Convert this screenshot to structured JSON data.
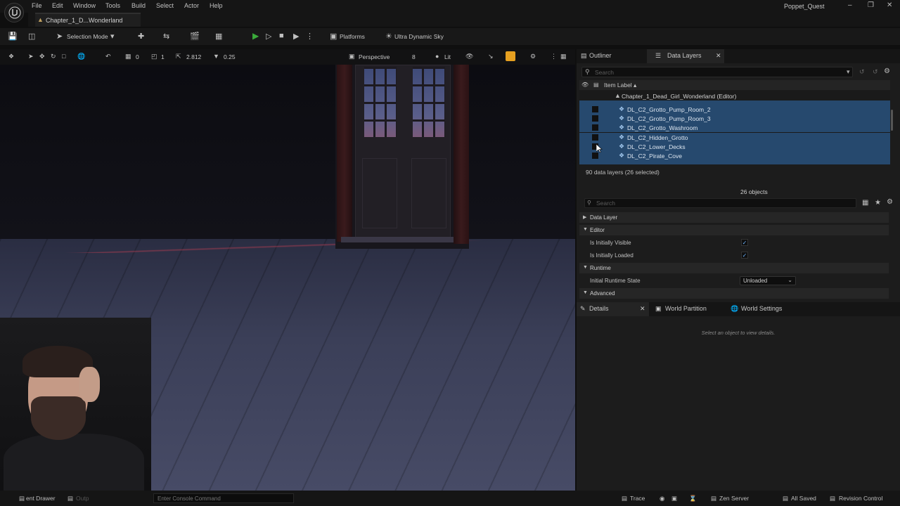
{
  "menu": {
    "items": [
      "File",
      "Edit",
      "Window",
      "Tools",
      "Build",
      "Select",
      "Actor",
      "Help"
    ],
    "project_title": "Poppet_Quest"
  },
  "level_tab": {
    "label": "Chapter_1_D...Wonderland"
  },
  "toolbar": {
    "selection_mode": "Selection Mode",
    "platforms": "Platforms",
    "sky": "Ultra Dynamic Sky"
  },
  "viewport_toolbar": {
    "grid_snap": "0",
    "rot_snap": "1",
    "scale_value": "2.812",
    "cam_speed": "0.25",
    "perspective": "Perspective",
    "fov": "8",
    "view_mode": "Lit"
  },
  "outliner": {
    "tabs": [
      "Outliner",
      "Data Layers"
    ],
    "search_placeholder": "Search",
    "column_header": "Item Label ▴",
    "world_row": "Chapter_1_Dead_Girl_Wonderland (Editor)",
    "rows": [
      "DL_C2_Grotto_Pump_Room_2",
      "DL_C2_Grotto_Pump_Room_3",
      "DL_C2_Grotto_Washroom",
      "DL_C2_Hidden_Grotto",
      "DL_C2_Lower_Decks",
      "DL_C2_Pirate_Cove"
    ],
    "count_text": "90 data layers (26 selected)"
  },
  "properties": {
    "objects_count": "26 objects",
    "search_placeholder": "Search",
    "sections": {
      "data_layer": "Data Layer",
      "editor": "Editor",
      "runtime": "Runtime",
      "advanced": "Advanced"
    },
    "initially_visible": "Is Initially Visible",
    "initially_loaded": "Is Initially Loaded",
    "initial_runtime_state": "Initial Runtime State",
    "runtime_state_value": "Unloaded"
  },
  "details": {
    "tabs": [
      "Details",
      "World Partition",
      "World Settings"
    ],
    "empty_text": "Select an object to view details."
  },
  "statusbar": {
    "content_drawer": "ent Drawer",
    "output_log": "Outp",
    "console_placeholder": "Enter Console Command",
    "trace": "Trace",
    "zen_server": "Zen Server",
    "all_saved": "All Saved",
    "revision_control": "Revision Control"
  },
  "colors": {
    "selection_blue": "#26496e",
    "play_green": "#3aaa3a",
    "realtime_orange": "#e6a020"
  }
}
